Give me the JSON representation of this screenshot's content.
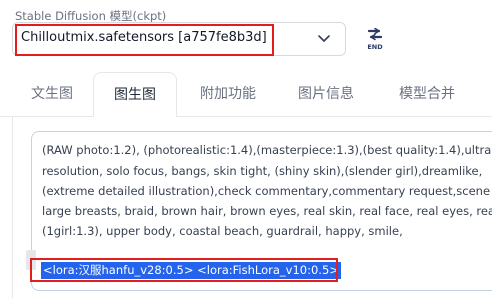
{
  "checkpoint": {
    "label": "Stable Diffusion 模型(ckpt)",
    "selected": "Chilloutmix.safetensors [a757fe8b3d]",
    "end_button_text": "END"
  },
  "tabs": [
    {
      "label": "文生图",
      "active": false
    },
    {
      "label": "图生图",
      "active": true
    },
    {
      "label": "附加功能",
      "active": false
    },
    {
      "label": "图片信息",
      "active": false
    },
    {
      "label": "模型合并",
      "active": false
    }
  ],
  "prompt": {
    "lines": [
      "(RAW photo:1.2), (photorealistic:1.4),(masterpiece:1.3),(best quality:1.4),ultra",
      "resolution, solo focus, bangs, skin tight, (shiny skin),(slender girl),dreamlike,",
      "(extreme detailed illustration),check commentary,commentary request,scene",
      "large breasts, braid, brown hair, brown eyes, real skin, real face, real eyes, real",
      "(1girl:1.3), upper body, coastal beach, guardrail, happy, smile,"
    ],
    "selected_line": "<lora:汉服hanfu_v28:0.5> <lora:FishLora_v10:0.5>"
  },
  "colors": {
    "highlight_border": "#e11d1d",
    "selection_bg": "#2463eb",
    "end_icon": "#2b3a67"
  }
}
